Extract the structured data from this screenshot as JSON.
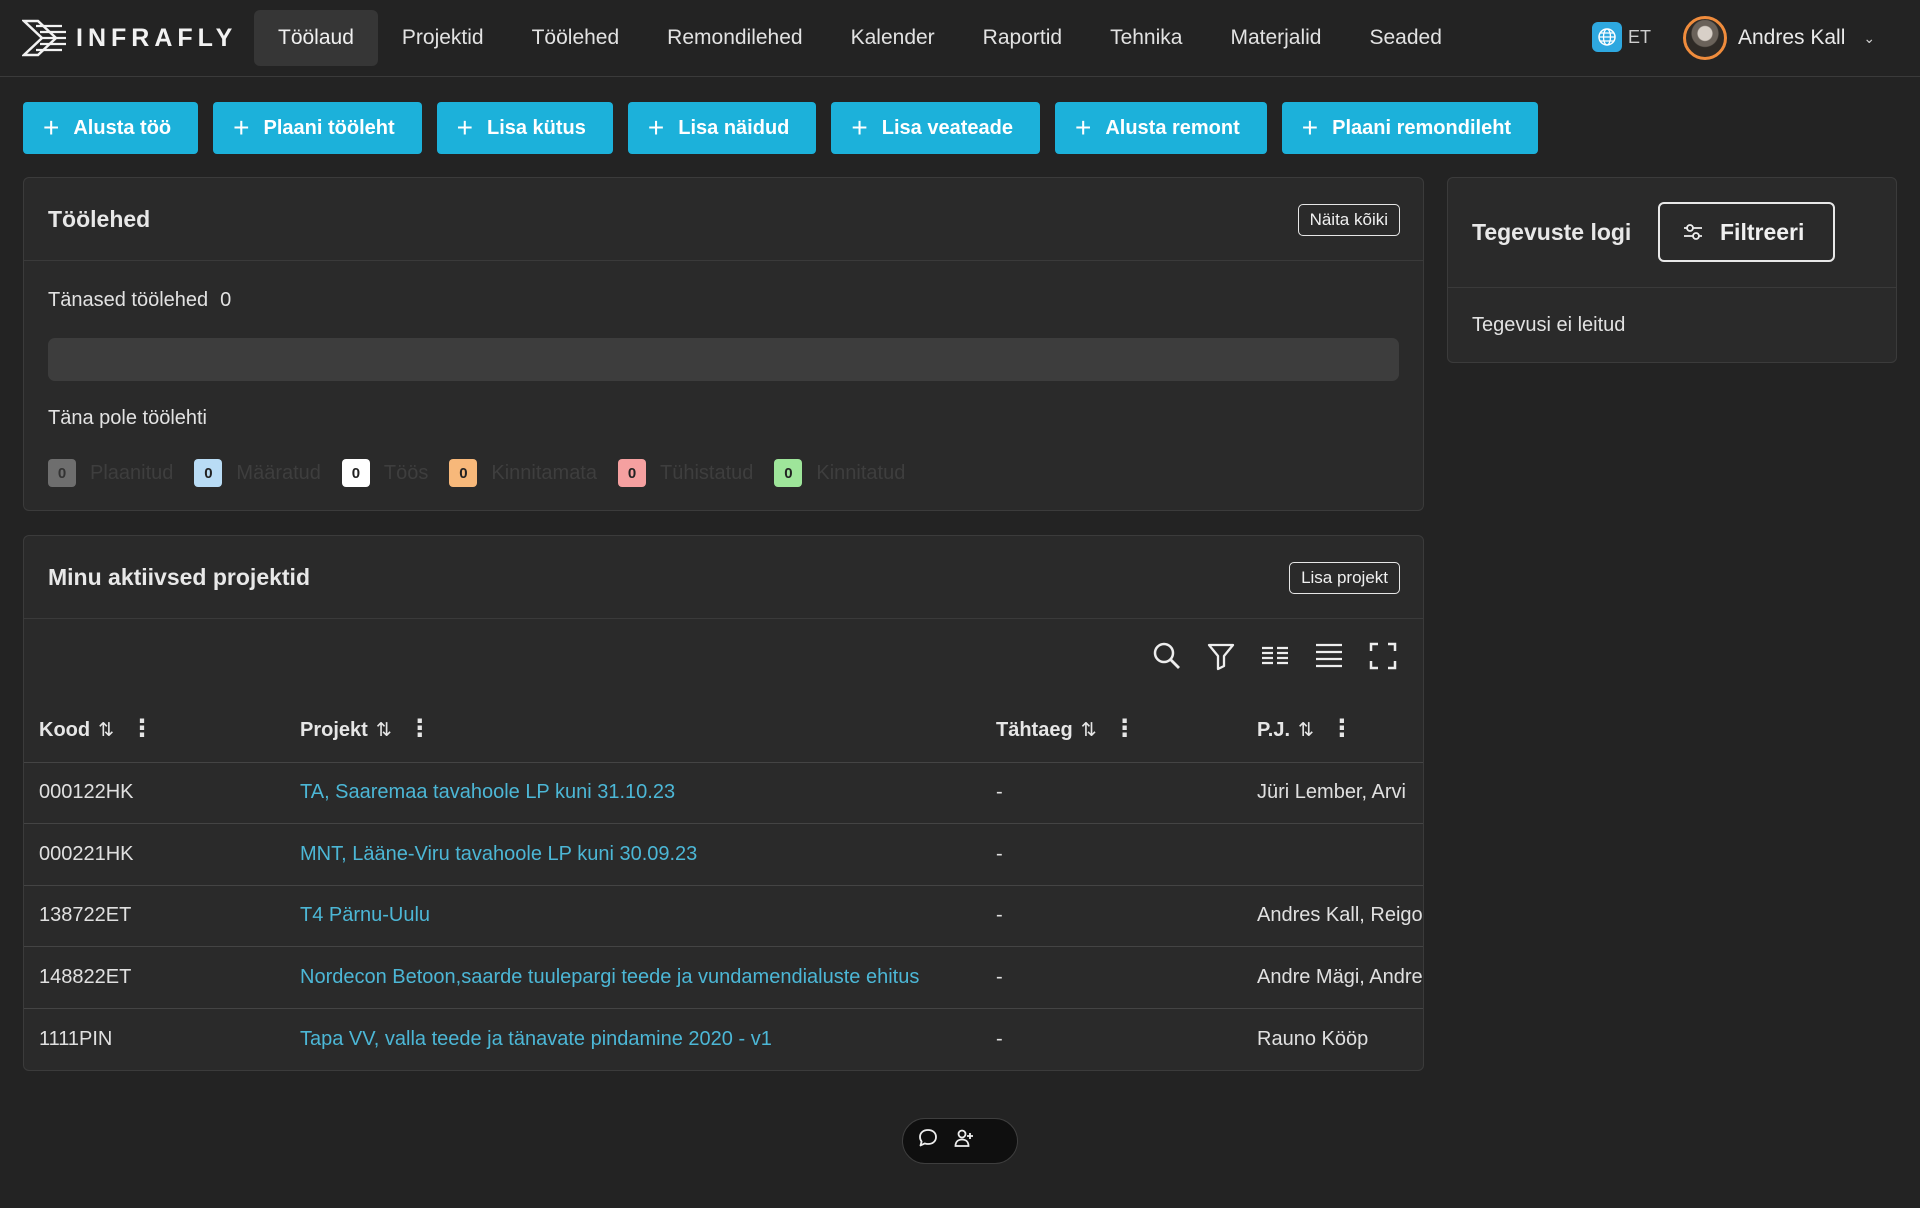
{
  "brand": {
    "name": "INFRAFLY"
  },
  "nav": {
    "items": [
      {
        "label": "Töölaud",
        "active": true
      },
      {
        "label": "Projektid"
      },
      {
        "label": "Töölehed"
      },
      {
        "label": "Remondilehed"
      },
      {
        "label": "Kalender"
      },
      {
        "label": "Raportid"
      },
      {
        "label": "Tehnika"
      },
      {
        "label": "Materjalid"
      },
      {
        "label": "Seaded"
      }
    ]
  },
  "language": {
    "code": "ET",
    "icon": "globe-icon"
  },
  "user": {
    "name": "Andres Kall"
  },
  "actions": [
    {
      "label": "Alusta töö"
    },
    {
      "label": "Plaani tööleht"
    },
    {
      "label": "Lisa kütus"
    },
    {
      "label": "Lisa näidud"
    },
    {
      "label": "Lisa veateade"
    },
    {
      "label": "Alusta remont"
    },
    {
      "label": "Plaani remondileht"
    }
  ],
  "worksheets": {
    "title": "Töölehed",
    "show_all": "Näita kõiki",
    "today_label": "Tänased töölehed",
    "today_count": "0",
    "empty": "Täna pole töölehti",
    "statuses": [
      {
        "count": "0",
        "label": "Plaanitud",
        "color": "#6e6e6e"
      },
      {
        "count": "0",
        "label": "Määratud",
        "color": "#b9dcf5"
      },
      {
        "count": "0",
        "label": "Töös",
        "color": "#ffffff"
      },
      {
        "count": "0",
        "label": "Kinnitamata",
        "color": "#f7b87a"
      },
      {
        "count": "0",
        "label": "Tühistatud",
        "color": "#f5a0a0"
      },
      {
        "count": "0",
        "label": "Kinnitatud",
        "color": "#9ee59a"
      }
    ]
  },
  "activity_log": {
    "title": "Tegevuste logi",
    "filter": "Filtreeri",
    "empty": "Tegevusi ei leitud"
  },
  "projects": {
    "title": "Minu aktiivsed projektid",
    "add": "Lisa projekt",
    "toolbar": [
      "search-icon",
      "filter-icon",
      "columns-icon",
      "density-icon",
      "fullscreen-icon"
    ],
    "columns": [
      "Kood",
      "Projekt",
      "Tähtaeg",
      "P.J."
    ],
    "rows": [
      {
        "code": "000122HK",
        "name": "TA, Saaremaa tavahoole LP kuni 31.10.23",
        "deadline": "-",
        "pm": "Jüri Lember, Arvi"
      },
      {
        "code": "000221HK",
        "name": "MNT, Lääne-Viru tavahoole LP kuni 30.09.23",
        "deadline": "-",
        "pm": ""
      },
      {
        "code": "138722ET",
        "name": "T4 Pärnu-Uulu",
        "deadline": "-",
        "pm": "Andres Kall, Reigo"
      },
      {
        "code": "148822ET",
        "name": "Nordecon Betoon,saarde tuulepargi teede ja vundamendialuste ehitus",
        "deadline": "-",
        "pm": "Andre Mägi, Andre"
      },
      {
        "code": "1111PIN",
        "name": "Tapa VV, valla teede ja tänavate pindamine 2020 - v1",
        "deadline": "-",
        "pm": "Rauno Kööp"
      }
    ]
  },
  "float_widget": {
    "icons": [
      "chat-icon",
      "user-add-icon"
    ]
  }
}
